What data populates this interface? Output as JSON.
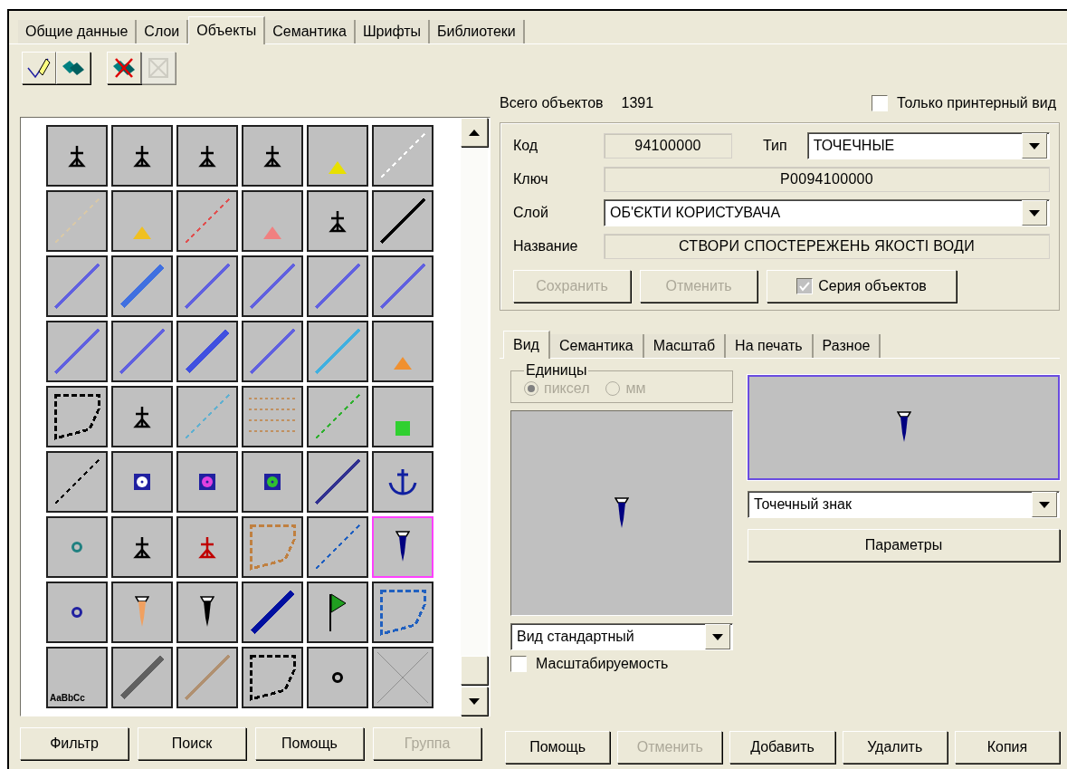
{
  "tabs": [
    {
      "label": "Общие данные",
      "selected": false
    },
    {
      "label": "Слои",
      "selected": false
    },
    {
      "label": "Объекты",
      "selected": true
    },
    {
      "label": "Семантика",
      "selected": false
    },
    {
      "label": "Шрифты",
      "selected": false
    },
    {
      "label": "Библиотеки",
      "selected": false
    }
  ],
  "toolbar": [
    {
      "kind": "edit",
      "disabled": false
    },
    {
      "kind": "layers",
      "disabled": false
    },
    {
      "kind": "delete",
      "disabled": false
    },
    {
      "kind": "clear",
      "disabled": true
    }
  ],
  "symbols": [
    {
      "kind": "glyph",
      "color": "#000000",
      "selected": false
    },
    {
      "kind": "glyph",
      "color": "#000000",
      "selected": false
    },
    {
      "kind": "glyph",
      "color": "#000000",
      "selected": false
    },
    {
      "kind": "glyph",
      "color": "#000000",
      "selected": false
    },
    {
      "kind": "triangle",
      "color": "#e8e000",
      "selected": false
    },
    {
      "kind": "dashed-line",
      "color": "#ffffff",
      "selected": false
    },
    {
      "kind": "dashed-line",
      "color": "#d8c8a8",
      "selected": false
    },
    {
      "kind": "triangle",
      "color": "#f0c020",
      "selected": false
    },
    {
      "kind": "dashed-line",
      "color": "#e05050",
      "selected": false
    },
    {
      "kind": "triangle",
      "color": "#f08080",
      "selected": false
    },
    {
      "kind": "glyph",
      "color": "#000000",
      "selected": false
    },
    {
      "kind": "line",
      "color": "#000000",
      "selected": false
    },
    {
      "kind": "line",
      "color": "#6060e0",
      "selected": false
    },
    {
      "kind": "thick-line",
      "color": "#4070e0",
      "selected": false
    },
    {
      "kind": "line",
      "color": "#6060e0",
      "selected": false
    },
    {
      "kind": "line",
      "color": "#6060e0",
      "selected": false
    },
    {
      "kind": "line",
      "color": "#6060e0",
      "selected": false
    },
    {
      "kind": "line",
      "color": "#6060e0",
      "selected": false
    },
    {
      "kind": "line",
      "color": "#6060e0",
      "selected": false
    },
    {
      "kind": "line",
      "color": "#6060e0",
      "selected": false
    },
    {
      "kind": "thick-line",
      "color": "#4050e0",
      "selected": false
    },
    {
      "kind": "line",
      "color": "#6060e0",
      "selected": false
    },
    {
      "kind": "line",
      "color": "#40b0e0",
      "selected": false
    },
    {
      "kind": "triangle",
      "color": "#f09030",
      "selected": false
    },
    {
      "kind": "area",
      "color": "#000000",
      "selected": false
    },
    {
      "kind": "glyph",
      "color": "#000000",
      "selected": false
    },
    {
      "kind": "dashed-line",
      "color": "#60b0d0",
      "selected": false
    },
    {
      "kind": "hatch",
      "color": "#c09060",
      "selected": false
    },
    {
      "kind": "dashed-line",
      "color": "#30b030",
      "selected": false
    },
    {
      "kind": "square",
      "color": "#30d030",
      "selected": false
    },
    {
      "kind": "dashed-line",
      "color": "#000000",
      "selected": false
    },
    {
      "kind": "target",
      "color": "#ffffff",
      "selected": false
    },
    {
      "kind": "target",
      "color": "#e040e0",
      "selected": false
    },
    {
      "kind": "target",
      "color": "#30c030",
      "selected": false
    },
    {
      "kind": "line",
      "color": "#303090",
      "selected": false
    },
    {
      "kind": "anchor",
      "color": "#1020a0",
      "selected": false
    },
    {
      "kind": "dot",
      "color": "#208080",
      "selected": false
    },
    {
      "kind": "glyph",
      "color": "#000000",
      "selected": false
    },
    {
      "kind": "glyph",
      "color": "#c00000",
      "selected": false
    },
    {
      "kind": "area",
      "color": "#c08040",
      "selected": false
    },
    {
      "kind": "dashed-line",
      "color": "#2060c0",
      "selected": false
    },
    {
      "kind": "marker",
      "color": "#000080",
      "selected": true
    },
    {
      "kind": "dot",
      "color": "#2020a0",
      "selected": false
    },
    {
      "kind": "marker",
      "color": "#f0a060",
      "selected": false
    },
    {
      "kind": "marker",
      "color": "#000000",
      "selected": false
    },
    {
      "kind": "thick-line",
      "color": "#0010a0",
      "selected": false
    },
    {
      "kind": "flag",
      "color": "#20a020",
      "selected": false
    },
    {
      "kind": "area",
      "color": "#2060c0",
      "selected": false
    },
    {
      "kind": "text",
      "label": "AaBbCc",
      "color": "#000000",
      "selected": false
    },
    {
      "kind": "thick-line",
      "color": "#606060",
      "selected": false
    },
    {
      "kind": "line",
      "color": "#b09070",
      "selected": false
    },
    {
      "kind": "area",
      "color": "#000000",
      "selected": false
    },
    {
      "kind": "dot",
      "color": "#000000",
      "selected": false
    },
    {
      "kind": "none",
      "color": "#909090",
      "selected": false
    }
  ],
  "left_buttons": [
    {
      "label": "Фильтр",
      "disabled": false
    },
    {
      "label": "Поиск",
      "disabled": false
    },
    {
      "label": "Помощь",
      "disabled": false
    },
    {
      "label": "Группа",
      "disabled": true
    }
  ],
  "total": {
    "label": "Всего объектов",
    "value": "1391"
  },
  "printer_only": {
    "label": "Только принтерный вид",
    "checked": false
  },
  "object": {
    "code": {
      "label": "Код",
      "value": "94100000"
    },
    "type": {
      "label": "Тип",
      "value": "ТОЧЕЧНЫЕ"
    },
    "key": {
      "label": "Ключ",
      "value": "P0094100000"
    },
    "layer": {
      "label": "Слой",
      "value": "ОБ'ЄКТИ КОРИСТУВАЧА"
    },
    "name": {
      "label": "Название",
      "value": "СТВОРИ СПОСТЕРЕЖЕНЬ ЯКОСТІ ВОДИ"
    }
  },
  "object_buttons": [
    {
      "label": "Сохранить",
      "disabled": true
    },
    {
      "label": "Отменить",
      "disabled": true
    }
  ],
  "series": {
    "label": "Серия объектов",
    "checked": true
  },
  "sub_tabs": [
    {
      "label": "Вид",
      "selected": true
    },
    {
      "label": "Семантика",
      "selected": false
    },
    {
      "label": "Масштаб",
      "selected": false
    },
    {
      "label": "На печать",
      "selected": false
    },
    {
      "label": "Разное",
      "selected": false
    }
  ],
  "units": {
    "title": "Единицы",
    "options": [
      {
        "label": "пиксел",
        "selected": true,
        "disabled": true
      },
      {
        "label": "мм",
        "selected": false,
        "disabled": true
      }
    ]
  },
  "view_select": {
    "value": "Вид стандартный"
  },
  "scalable": {
    "label": "Масштабируемость",
    "checked": false
  },
  "sign_select": {
    "value": "Точечный знак"
  },
  "params_button": {
    "label": "Параметры"
  },
  "bottom_buttons": [
    {
      "label": "Помощь",
      "disabled": false
    },
    {
      "label": "Отменить",
      "disabled": true
    },
    {
      "label": "Добавить",
      "disabled": false
    },
    {
      "label": "Удалить",
      "disabled": false
    },
    {
      "label": "Копия",
      "disabled": false
    }
  ]
}
